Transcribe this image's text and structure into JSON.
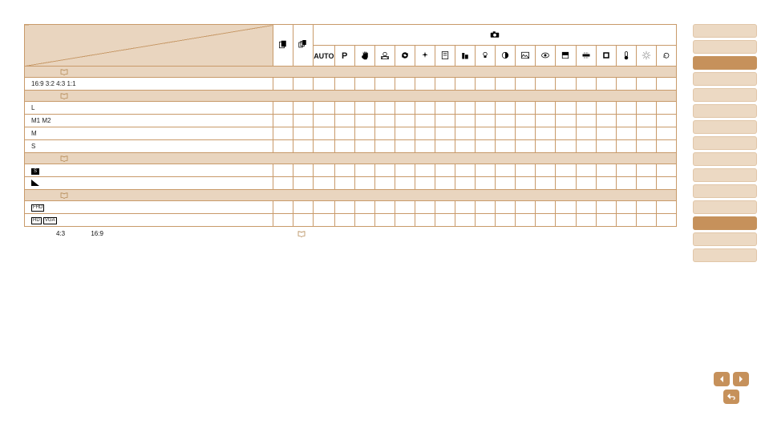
{
  "header": {
    "camera_icon": "camera-icon",
    "modes": [
      "card-icon",
      "cards-icon",
      "AUTO",
      "P",
      "hand-icon",
      "face-icon",
      "cycle-icon",
      "sparkle-icon",
      "doc-icon",
      "building-icon",
      "bulb-icon",
      "contrast-icon",
      "landscape-icon",
      "fisheye-icon",
      "grad-icon",
      "tilt-icon",
      "square-icon",
      "temp-icon",
      "gear-icon",
      "refresh-icon"
    ]
  },
  "sections": [
    {
      "type": "sub",
      "label": "",
      "ref": ""
    },
    {
      "type": "row",
      "label": "16:9 3:2 4:3 1:1"
    },
    {
      "type": "sub",
      "label": "",
      "ref": ""
    },
    {
      "type": "row",
      "label": "L"
    },
    {
      "type": "row",
      "label": "M1 M2"
    },
    {
      "type": "row",
      "label": "M"
    },
    {
      "type": "row",
      "label": "S"
    },
    {
      "type": "sub",
      "label": "",
      "ref": ""
    },
    {
      "type": "row",
      "label": "fine-icon",
      "icon": "filled-s"
    },
    {
      "type": "row",
      "label": "normal-icon",
      "icon": "tri"
    },
    {
      "type": "sub",
      "label": "",
      "ref": ""
    },
    {
      "type": "row",
      "label": "FHD",
      "icon": "box"
    },
    {
      "type": "row",
      "label": "HD VGA",
      "icon": "box2"
    }
  ],
  "footnote": {
    "a": "4:3",
    "b": "16:9",
    "ref_icon": "book-icon"
  },
  "sidebar": {
    "tabs": 15,
    "active": 3
  },
  "pager": {
    "prev": "prev",
    "next": "next",
    "back": "back"
  }
}
